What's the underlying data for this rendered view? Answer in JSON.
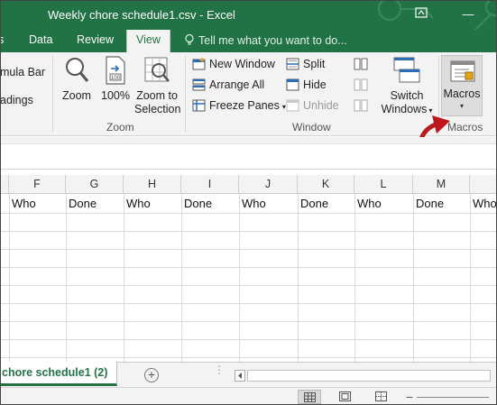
{
  "window": {
    "title": "Weekly chore schedule1.csv - Excel",
    "restore_icon": "ribbon-display-options-icon",
    "minimize_label": "—",
    "accent_color": "#217346"
  },
  "ribbon_tabs": {
    "data": "Data",
    "review": "Review",
    "view": "View",
    "tell_me": "Tell me what you want to do..."
  },
  "show_group": {
    "formula_bar_label": "mula Bar",
    "headings_label": "adings"
  },
  "zoom_group": {
    "zoom_label": "Zoom",
    "zoom100_label": "100%",
    "zoom_selection_line1": "Zoom to",
    "zoom_selection_line2": "Selection",
    "group_label": "Zoom"
  },
  "window_group": {
    "new_window": "New Window",
    "arrange_all": "Arrange All",
    "freeze_panes": "Freeze Panes",
    "split": "Split",
    "hide": "Hide",
    "unhide": "Unhide",
    "switch_line1": "Switch",
    "switch_line2": "Windows",
    "group_label": "Window"
  },
  "macros_group": {
    "macros_label": "Macros",
    "group_label": "Macros",
    "annotation_arrow_color": "#c0151b"
  },
  "columns": [
    "F",
    "G",
    "H",
    "I",
    "J",
    "K",
    "L",
    "M"
  ],
  "header_row": [
    "Who",
    "Done",
    "Who",
    "Done",
    "Who",
    "Done",
    "Who",
    "Done",
    "Who"
  ],
  "sheet_tabs": {
    "active_tab": "chore schedule1 (2)",
    "add_sheet_symbol": "+"
  },
  "status_bar": {
    "normal_view_icon": "normal-view-icon",
    "page_layout_icon": "page-layout-icon",
    "page_break_icon": "page-break-preview-icon",
    "zoom_minus": "−"
  }
}
